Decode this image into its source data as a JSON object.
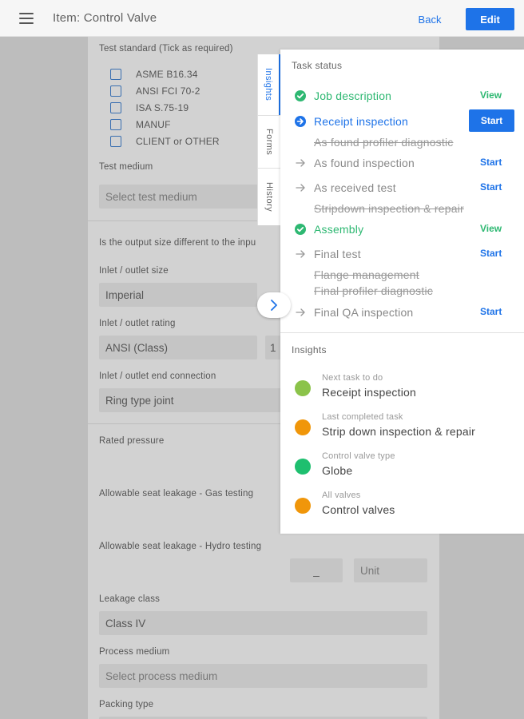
{
  "header": {
    "title": "Item: Control Valve",
    "back_label": "Back",
    "edit_label": "Edit",
    "accent_color": "#1e73e8"
  },
  "form": {
    "test_standard_label": "Test standard (Tick as required)",
    "standards": [
      "ASME B16.34",
      "ANSI FCI 70-2",
      "ISA S.75-19",
      "MANUF",
      "CLIENT or OTHER"
    ],
    "test_medium_label": "Test medium",
    "test_medium_placeholder": "Select test medium",
    "output_size_question": "Is the output size different to the inpu",
    "inlet_size_label": "Inlet / outlet size",
    "inlet_size_value": "Imperial",
    "inlet_rating_label": "Inlet / outlet rating",
    "inlet_rating_value": "ANSI (Class)",
    "inlet_rating_value_2": "1",
    "end_connection_label": "Inlet / outlet end connection",
    "end_connection_value": "Ring type joint",
    "rated_pressure_label": "Rated pressure",
    "seat_leakage_gas_label": "Allowable seat leakage - Gas testing",
    "seat_leakage_hydro_label": "Allowable seat leakage - Hydro testing",
    "hydro_value": "_",
    "hydro_unit_placeholder": "Unit",
    "leakage_class_label": "Leakage class",
    "leakage_class_value": "Class IV",
    "process_medium_label": "Process medium",
    "process_medium_placeholder": "Select process medium",
    "packing_type_label": "Packing type"
  },
  "side_tabs": [
    "Insights",
    "Forms",
    "History"
  ],
  "task_status": {
    "heading": "Task status",
    "tasks": [
      {
        "name": "Job description",
        "state": "done",
        "action": "View"
      },
      {
        "name": "Receipt inspection",
        "state": "active",
        "action": "Start"
      },
      {
        "name": "As found profiler diagnostic",
        "state": "struck",
        "action": ""
      },
      {
        "name": "As found inspection",
        "state": "pending",
        "action": "Start"
      },
      {
        "name": "As received test",
        "state": "pending",
        "action": "Start"
      },
      {
        "name": "Stripdown inspection & repair",
        "state": "struck",
        "action": ""
      },
      {
        "name": "Assembly",
        "state": "done",
        "action": "View"
      },
      {
        "name": "Final test",
        "state": "pending",
        "action": "Start"
      },
      {
        "name": "Flange management",
        "state": "struck",
        "action": ""
      },
      {
        "name": "Final profiler diagnostic",
        "state": "struck",
        "action": ""
      },
      {
        "name": "Final QA inspection",
        "state": "pending",
        "action": "Start"
      }
    ]
  },
  "insights": {
    "heading": "Insights",
    "items": [
      {
        "label": "Next task to do",
        "value": "Receipt inspection",
        "color": "#8bc34a"
      },
      {
        "label": "Last completed task",
        "value": "Strip down inspection & repair",
        "color": "#f0960a"
      },
      {
        "label": "Control valve type",
        "value": "Globe",
        "color": "#1ebf6f"
      },
      {
        "label": "All valves",
        "value": "Control valves",
        "color": "#f0960a"
      }
    ]
  },
  "colors": {
    "done": "#2eb872",
    "active": "#1e73e8",
    "pending": "#888888"
  }
}
